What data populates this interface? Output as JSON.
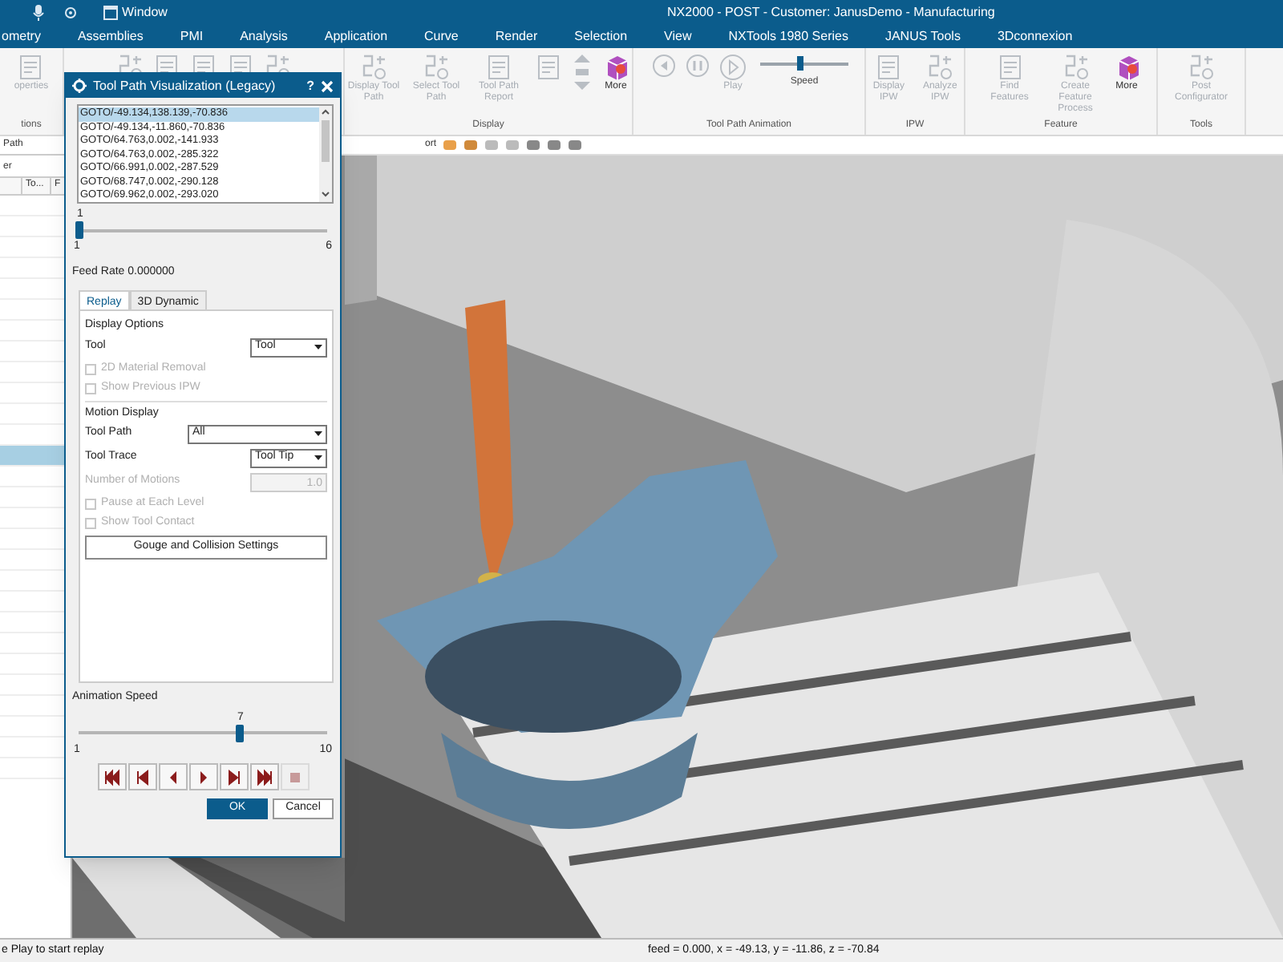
{
  "title_bar": {
    "quick_access": "Window",
    "title": "NX2000 - POST - Customer: JanusDemo - Manufacturing"
  },
  "menu_tabs": [
    {
      "label": "ometry",
      "selected": false
    },
    {
      "label": "Assemblies",
      "selected": false
    },
    {
      "label": "PMI",
      "selected": false
    },
    {
      "label": "Analysis",
      "selected": false
    },
    {
      "label": "Application",
      "selected": false
    },
    {
      "label": "Curve",
      "selected": false
    },
    {
      "label": "Render",
      "selected": false
    },
    {
      "label": "Selection",
      "selected": false
    },
    {
      "label": "View",
      "selected": false
    },
    {
      "label": "NXTools 1980 Series",
      "selected": false
    },
    {
      "label": "JANUS Tools",
      "selected": false
    },
    {
      "label": "3Dconnexion",
      "selected": false
    }
  ],
  "ribbon": {
    "groups": [
      {
        "label": "tions",
        "buttons": [
          {
            "kind": "sheet",
            "label": "operties",
            "disabled": true
          }
        ]
      },
      {
        "buttons": [
          {
            "kind": "path",
            "disabled": true
          },
          {
            "kind": "sheet",
            "disabled": true
          },
          {
            "kind": "sheet",
            "disabled": true
          },
          {
            "kind": "sheet",
            "disabled": true
          },
          {
            "kind": "path",
            "disabled": true
          }
        ]
      },
      {
        "label": "Display",
        "buttons": [
          {
            "kind": "path",
            "label": "Display Tool Path",
            "disabled": true
          },
          {
            "kind": "path",
            "label": "Select Tool Path",
            "disabled": true
          },
          {
            "kind": "sheet",
            "label": "Tool Path Report",
            "disabled": true
          },
          {
            "kind": "sheet",
            "disabled": true
          },
          {
            "kind": "arrows",
            "disabled": true
          },
          {
            "kind": "cube",
            "label": "More",
            "disabled": false
          }
        ]
      },
      {
        "label": "Tool Path Animation",
        "buttons": [
          {
            "kind": "back",
            "disabled": true
          },
          {
            "kind": "pause",
            "disabled": true
          },
          {
            "kind": "play",
            "label": "Play",
            "disabled": true
          }
        ],
        "slider": {
          "label": "Speed",
          "level": 0.45
        }
      },
      {
        "label": "IPW",
        "buttons": [
          {
            "kind": "sheet",
            "label": "Display IPW",
            "disabled": true
          },
          {
            "kind": "path",
            "label": "Analyze IPW",
            "disabled": true
          }
        ]
      },
      {
        "label": "Feature",
        "buttons": [
          {
            "kind": "sheet",
            "label": "Find Features",
            "disabled": true
          },
          {
            "kind": "path",
            "label": "Create Feature Process",
            "disabled": true
          },
          {
            "kind": "cube",
            "label": "More",
            "disabled": false
          }
        ]
      },
      {
        "label": "Tools",
        "buttons": [
          {
            "kind": "path",
            "label": "Post Configurator",
            "disabled": true
          }
        ]
      }
    ]
  },
  "navigator": {
    "filter": "Path",
    "label": "er",
    "columns": [
      "To...",
      "F"
    ],
    "rows": [
      {
        "selected": false
      },
      {
        "selected": false
      },
      {
        "selected": false
      },
      {
        "selected": false
      },
      {
        "selected": false
      },
      {
        "selected": false
      },
      {
        "selected": false
      },
      {
        "selected": false
      },
      {
        "selected": false
      },
      {
        "selected": false
      },
      {
        "selected": false
      },
      {
        "selected": false
      },
      {
        "selected": true
      },
      {
        "selected": false
      },
      {
        "selected": false
      },
      {
        "selected": false
      },
      {
        "selected": false
      },
      {
        "selected": false
      },
      {
        "selected": false
      },
      {
        "selected": false
      },
      {
        "selected": false
      },
      {
        "selected": false
      },
      {
        "selected": false
      },
      {
        "selected": false
      },
      {
        "selected": false
      },
      {
        "selected": false
      },
      {
        "selected": false
      },
      {
        "selected": false
      }
    ]
  },
  "viewport": {
    "tab": "ort"
  },
  "dialog": {
    "title": "Tool Path Visualization (Legacy)",
    "help": "?",
    "motions": [
      {
        "text": "GOTO/-49.134,138.139,-70.836",
        "selected": true
      },
      {
        "text": "GOTO/-49.134,-11.860,-70.836",
        "selected": false
      },
      {
        "text": "GOTO/64.763,0.002,-141.933",
        "selected": false
      },
      {
        "text": "GOTO/64.763,0.002,-285.322",
        "selected": false
      },
      {
        "text": "GOTO/66.991,0.002,-287.529",
        "selected": false
      },
      {
        "text": "GOTO/68.747,0.002,-290.128",
        "selected": false
      },
      {
        "text": "GOTO/69.962,0.002,-293.020",
        "selected": false
      }
    ],
    "position_slider": {
      "value": "1",
      "min": "1",
      "max": "6",
      "level": 0
    },
    "feed_rate": "Feed Rate 0.000000",
    "tabs": [
      {
        "label": "Replay",
        "selected": true
      },
      {
        "label": "3D Dynamic",
        "selected": false
      }
    ],
    "replay": [
      {
        "kind": "heading",
        "label": "Display Options"
      },
      {
        "kind": "dropdown",
        "label": "Tool",
        "value": "Tool"
      },
      {
        "kind": "checkbox",
        "label": "2D Material Removal",
        "checked": false,
        "disabled": true
      },
      {
        "kind": "checkbox",
        "label": "Show Previous IPW",
        "checked": false,
        "disabled": true
      },
      {
        "kind": "heading",
        "label": "Motion Display"
      },
      {
        "kind": "dropdown",
        "label": "Tool Path",
        "value": "All",
        "wide": true
      },
      {
        "kind": "dropdown",
        "label": "Tool Trace",
        "value": "Tool Tip"
      },
      {
        "kind": "number",
        "label": "Number of Motions",
        "value": "1.0",
        "disabled": true
      },
      {
        "kind": "checkbox",
        "label": "Pause at Each Level",
        "checked": false,
        "disabled": true
      },
      {
        "kind": "checkbox",
        "label": "Show Tool Contact",
        "checked": false,
        "disabled": true
      },
      {
        "kind": "button",
        "label": "Gouge and Collision Settings"
      }
    ],
    "animation_speed": {
      "label": "Animation Speed",
      "value": "7",
      "min": "1",
      "max": "10",
      "level": 0.667
    },
    "playback": [
      {
        "kind": "first",
        "disabled": false
      },
      {
        "kind": "step-back",
        "disabled": false
      },
      {
        "kind": "reverse",
        "disabled": false
      },
      {
        "kind": "play",
        "disabled": false
      },
      {
        "kind": "step-forward",
        "disabled": false
      },
      {
        "kind": "last",
        "disabled": false
      },
      {
        "kind": "stop",
        "disabled": true
      }
    ],
    "buttons": [
      {
        "label": "OK",
        "kind": "primary"
      },
      {
        "label": "Cancel",
        "kind": "secondary"
      }
    ]
  },
  "status_bar": {
    "prompt": "e Play to start replay",
    "readout": "feed = 0.000, x = -49.13, y = -11.86, z = -70.84"
  }
}
